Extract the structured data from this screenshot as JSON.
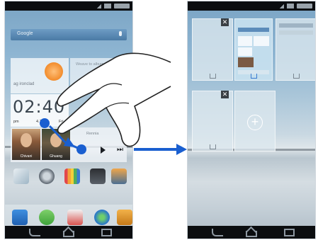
{
  "left_phone": {
    "search_placeholder": "Google",
    "weather_location": "ag ironclad",
    "photo_caption": "Weave to album",
    "clock_time": "02:40",
    "clock_ampm": "pm",
    "clock_date": "4.1",
    "clock_day": "Fri",
    "contacts": [
      "Chivani",
      "Ghuang"
    ],
    "music_label": "Rennia"
  },
  "right_phone": {
    "close_glyph": "✕",
    "add_glyph": "+"
  },
  "colors": {
    "accent_arrow": "#1a5fd0",
    "status_bar": "#0b0d10"
  }
}
